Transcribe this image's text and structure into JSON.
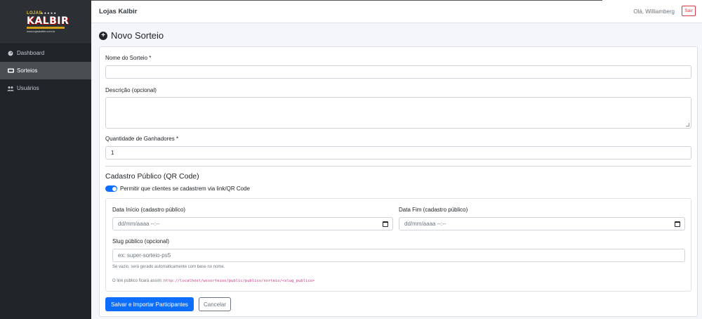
{
  "sidebar": {
    "logo": {
      "top": "LOJAS",
      "stars": "★★★★★",
      "main": "KALBIR",
      "url": "www.lojaskalbir.com.br"
    },
    "items": [
      {
        "label": "Dashboard",
        "icon": "dashboard-icon",
        "active": false
      },
      {
        "label": "Sorteios",
        "icon": "ticket-icon",
        "active": true
      },
      {
        "label": "Usuários",
        "icon": "users-icon",
        "active": false
      }
    ]
  },
  "header": {
    "brand": "Lojas Kalbir",
    "greeting": "Olá, Williamberg",
    "logout_label": "Sair"
  },
  "page": {
    "title": "Novo Sorteio"
  },
  "form": {
    "name": {
      "label": "Nome do Sorteio *",
      "value": ""
    },
    "description": {
      "label": "Descrição (opcional)",
      "value": ""
    },
    "winners": {
      "label": "Quantidade de Ganhadores *",
      "value": "1"
    },
    "public": {
      "section_title": "Cadastro Público (QR Code)",
      "toggle_label": "Permitir que clientes se cadastrem via link/QR Code",
      "toggle_on": true,
      "start": {
        "label": "Data Início (cadastro público)",
        "placeholder": "dd/mm/aaaa --:--"
      },
      "end": {
        "label": "Data Fim (cadastro público)",
        "placeholder": "dd/mm/aaaa --:--"
      },
      "slug": {
        "label": "Slug público (opcional)",
        "placeholder": "ex: super-sorteio-ps5"
      },
      "slug_help": "Se vazio, será gerado automaticamente com base no nome.",
      "link_help_prefix": "O link público ficará assim:",
      "link_example": "http://localhost/wssorteios/public/publico/sorteio/<slug_publico>"
    },
    "submit_label": "Salvar e Importar Participantes",
    "cancel_label": "Cancelar"
  },
  "colors": {
    "primary": "#0d6efd",
    "danger": "#dc3545",
    "sidebar_bg": "#212529",
    "sidebar_active": "#494e53",
    "code": "#d63384"
  }
}
